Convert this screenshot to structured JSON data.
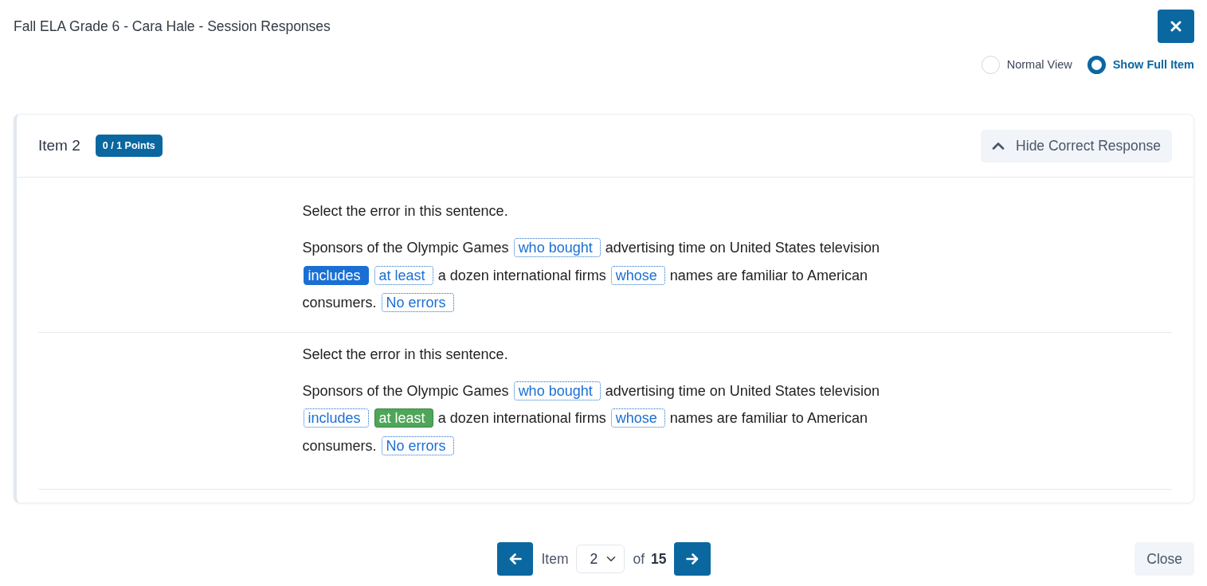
{
  "dialog": {
    "title": "Fall ELA Grade 6 - Cara Hale - Session Responses"
  },
  "view_options": [
    {
      "label": "Normal View",
      "selected": false
    },
    {
      "label": "Show Full Item",
      "selected": true
    }
  ],
  "item": {
    "title": "Item 2",
    "points": "0 / 1 Points",
    "toggle": {
      "label": "Hide Correct Response",
      "expanded": true
    }
  },
  "responses": [
    {
      "kind": "student",
      "prompt": "Select the error in this sentence.",
      "segments": [
        {
          "kind": "text",
          "text": "Sponsors of the Olympic Games"
        },
        {
          "kind": "choice",
          "text": "who bought",
          "selected": false
        },
        {
          "kind": "text",
          "text": "advertising time on United States television"
        },
        {
          "kind": "choice",
          "text": "includes",
          "selected": true
        },
        {
          "kind": "choice",
          "text": "at least",
          "selected": false
        },
        {
          "kind": "text",
          "text": "a dozen international firms"
        },
        {
          "kind": "choice",
          "text": "whose",
          "selected": false
        },
        {
          "kind": "text",
          "text": "names are familiar to American"
        },
        {
          "kind": "text",
          "text": "consumers."
        },
        {
          "kind": "choice",
          "text": "No errors",
          "selected": false
        }
      ]
    },
    {
      "kind": "correct",
      "prompt": "Select the error in this sentence.",
      "segments": [
        {
          "kind": "text",
          "text": "Sponsors of the Olympic Games"
        },
        {
          "kind": "choice",
          "text": "who bought",
          "selected": false
        },
        {
          "kind": "text",
          "text": "advertising time on United States television"
        },
        {
          "kind": "choice",
          "text": "includes",
          "selected": false
        },
        {
          "kind": "choice",
          "text": "at least",
          "selected": true
        },
        {
          "kind": "text",
          "text": "a dozen international firms"
        },
        {
          "kind": "choice",
          "text": "whose",
          "selected": false
        },
        {
          "kind": "text",
          "text": "names are familiar to American"
        },
        {
          "kind": "text",
          "text": "consumers."
        },
        {
          "kind": "choice",
          "text": "No errors",
          "selected": false
        }
      ]
    }
  ],
  "pagination": {
    "label": "Item",
    "value": "2",
    "of_label": "of",
    "total": "15"
  },
  "close_label": "Close"
}
